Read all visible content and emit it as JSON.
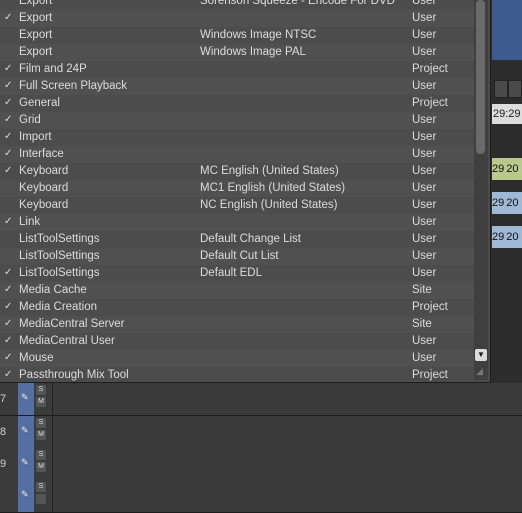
{
  "list": {
    "rows": [
      {
        "checked": false,
        "name": "Export",
        "config": "Sorenson Squeeze - Encode For DVD",
        "scope": "User"
      },
      {
        "checked": true,
        "name": "Export",
        "config": "",
        "scope": "User"
      },
      {
        "checked": false,
        "name": "Export",
        "config": "Windows Image NTSC",
        "scope": "User"
      },
      {
        "checked": false,
        "name": "Export",
        "config": "Windows Image PAL",
        "scope": "User"
      },
      {
        "checked": true,
        "name": "Film and 24P",
        "config": "",
        "scope": "Project"
      },
      {
        "checked": true,
        "name": "Full Screen Playback",
        "config": "",
        "scope": "User"
      },
      {
        "checked": true,
        "name": "General",
        "config": "",
        "scope": "Project"
      },
      {
        "checked": true,
        "name": "Grid",
        "config": "",
        "scope": "User"
      },
      {
        "checked": true,
        "name": "Import",
        "config": "",
        "scope": "User"
      },
      {
        "checked": true,
        "name": "Interface",
        "config": "",
        "scope": "User"
      },
      {
        "checked": true,
        "name": "Keyboard",
        "config": "MC English (United States)",
        "scope": "User"
      },
      {
        "checked": false,
        "name": "Keyboard",
        "config": "MC1 English (United States)",
        "scope": "User"
      },
      {
        "checked": false,
        "name": "Keyboard",
        "config": "NC English (United States)",
        "scope": "User"
      },
      {
        "checked": true,
        "name": "Link",
        "config": "",
        "scope": "User"
      },
      {
        "checked": false,
        "name": "ListToolSettings",
        "config": "Default Change List",
        "scope": "User"
      },
      {
        "checked": false,
        "name": "ListToolSettings",
        "config": "Default Cut List",
        "scope": "User"
      },
      {
        "checked": true,
        "name": "ListToolSettings",
        "config": "Default EDL",
        "scope": "User"
      },
      {
        "checked": true,
        "name": "Media Cache",
        "config": "",
        "scope": "Site"
      },
      {
        "checked": true,
        "name": "Media Creation",
        "config": "",
        "scope": "Project"
      },
      {
        "checked": true,
        "name": "MediaCentral Server",
        "config": "",
        "scope": "Site"
      },
      {
        "checked": true,
        "name": "MediaCentral User",
        "config": "",
        "scope": "User"
      },
      {
        "checked": true,
        "name": "Mouse",
        "config": "",
        "scope": "User"
      },
      {
        "checked": true,
        "name": "Passthrough Mix Tool",
        "config": "",
        "scope": "Project"
      }
    ],
    "check_glyph": "✓"
  },
  "timeline": {
    "tracks": [
      {
        "number": "7",
        "s": "S",
        "m": "M"
      },
      {
        "number": "8",
        "s": "S",
        "m": "M"
      },
      {
        "number": "9",
        "s": "S",
        "m": "M"
      },
      {
        "number": "",
        "s": "S",
        "m": ""
      }
    ],
    "edit_glyph": "✎",
    "right_timecode": "29:29",
    "right_clips": [
      "29",
      "29",
      "29"
    ],
    "right_clip_suffix": "20"
  },
  "icons": {
    "scroll_down": "▼",
    "resize_grip": "◢"
  },
  "colors": {
    "window_bg": "#4c4c4c",
    "track_select": "#5470a3",
    "clip_green": "#b9c98c",
    "clip_blue": "#9fb8d6"
  }
}
